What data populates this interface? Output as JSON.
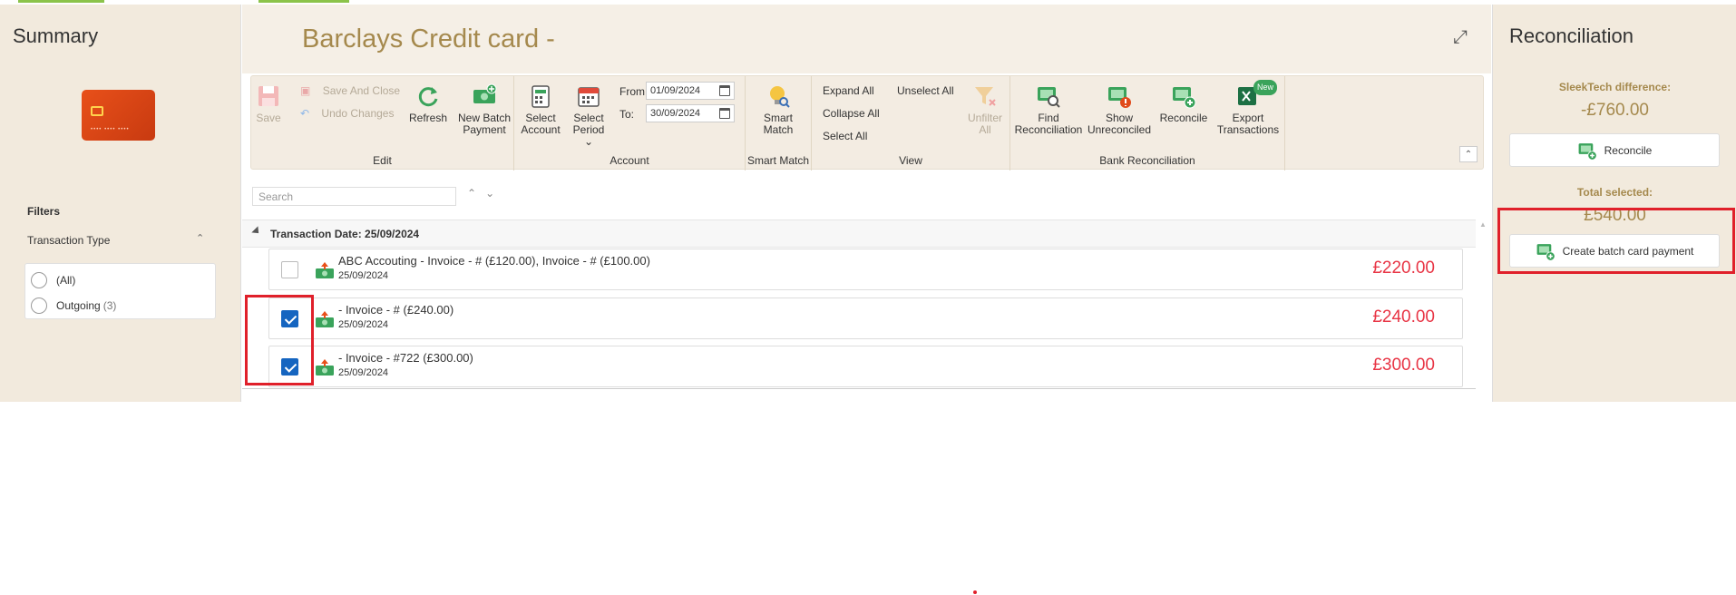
{
  "summary": {
    "title": "Summary",
    "card_number_mask": "•••• •••• ••••"
  },
  "filters": {
    "title": "Filters",
    "transaction_type_label": "Transaction Type",
    "options": [
      {
        "label": "(All)",
        "count": ""
      },
      {
        "label": "Outgoing",
        "count": "(3)"
      }
    ]
  },
  "main": {
    "title": "Barclays Credit card -"
  },
  "ribbon": {
    "edit": {
      "group_label": "Edit",
      "save": "Save",
      "save_and_close": "Save And Close",
      "undo_changes": "Undo Changes",
      "refresh": "Refresh",
      "new_batch_payment": "New Batch Payment"
    },
    "account": {
      "group_label": "Account",
      "select_account": "Select Account",
      "select_period": "Select Period",
      "from_label": "From:",
      "to_label": "To:",
      "from_value": "01/09/2024",
      "to_value": "30/09/2024"
    },
    "smart_match": {
      "group_label": "Smart Match",
      "smart_match": "Smart Match"
    },
    "view": {
      "group_label": "View",
      "expand_all": "Expand All",
      "collapse_all": "Collapse All",
      "select_all": "Select All",
      "unselect_all": "Unselect All",
      "unfilter_all": "Unfilter All"
    },
    "bank_reconciliation": {
      "group_label": "Bank Reconciliation",
      "find_reconciliation": "Find Reconciliation",
      "show_unreconciled": "Show Unreconciled",
      "reconcile": "Reconcile",
      "export_transactions": "Export Transactions",
      "new_badge": "New"
    }
  },
  "search": {
    "placeholder": "Search"
  },
  "transactions": {
    "group_header": "Transaction Date: 25/09/2024",
    "rows": [
      {
        "description": "ABC Accouting - Invoice - # (£120.00), Invoice - # (£100.00)",
        "date": "25/09/2024",
        "amount": "£220.00",
        "checked": false
      },
      {
        "description": " - Invoice - # (£240.00)",
        "date": "25/09/2024",
        "amount": "£240.00",
        "checked": true
      },
      {
        "description": " - Invoice - #722 (£300.00)",
        "date": "25/09/2024",
        "amount": "£300.00",
        "checked": true
      }
    ]
  },
  "reconciliation": {
    "title": "Reconciliation",
    "difference_label": "SleekTech difference:",
    "difference_value": "-£760.00",
    "reconcile_button": "Reconcile",
    "total_selected_label": "Total selected:",
    "total_selected_value": "£540.00",
    "create_batch_button": "Create batch card payment"
  },
  "colors": {
    "accent": "#a5894d",
    "amount": "#e83545",
    "highlight": "#e0202a",
    "checkbox": "#1565c0"
  }
}
